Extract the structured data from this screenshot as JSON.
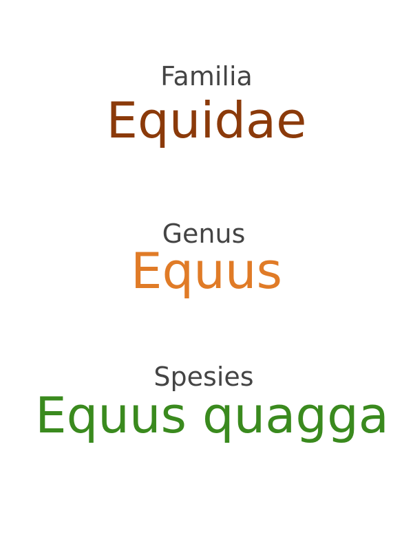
{
  "taxonomy": {
    "familia": {
      "label": "Familia",
      "name": "Equidae",
      "color": "#8b3a0a"
    },
    "genus": {
      "label": "Genus",
      "name": "Equus",
      "color": "#e07b27"
    },
    "spesies": {
      "label": "Spesies",
      "name": "Equus quagga",
      "color": "#3a8a1e"
    }
  }
}
